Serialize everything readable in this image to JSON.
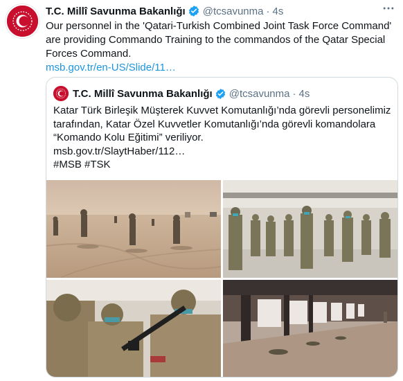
{
  "tweet": {
    "display_name": "T.C. Millî Savunma Bakanlığı",
    "handle": "@tcsavunma",
    "separator": "·",
    "time": "4s",
    "more_icon": "ellipsis-icon",
    "text": "Our personnel in the 'Qatari-Turkish Combined Joint Task Force Command' are providing Commando Training to the commandos of the Qatar Special Forces Command.",
    "link": "msb.gov.tr/en-US/Slide/11…"
  },
  "quoted_tweet": {
    "display_name": "T.C. Millî Savunma Bakanlığı",
    "handle": "@tcsavunma",
    "separator": "·",
    "time": "4s",
    "text": "Katar Türk Birleşik Müşterek Kuvvet Komutanlığı’nda görevli personelimiz tarafından, Katar Özel Kuvvetler Komutanlığı’nda görevli komandolara “Komando Kolu Eğitimi” veriliyor.",
    "link": "msb.gov.tr/SlaytHaber/112…",
    "hashtags": "#MSB #TSK",
    "photos": [
      "desert-training-photo",
      "indoor-formation-photo",
      "weapon-drill-photo",
      "hangar-range-photo"
    ]
  },
  "colors": {
    "brand_red": "#c8102e",
    "link_blue": "#1b95e0",
    "verified_blue": "#1da1f2",
    "muted": "#5b7083",
    "border": "#cfd9de"
  }
}
